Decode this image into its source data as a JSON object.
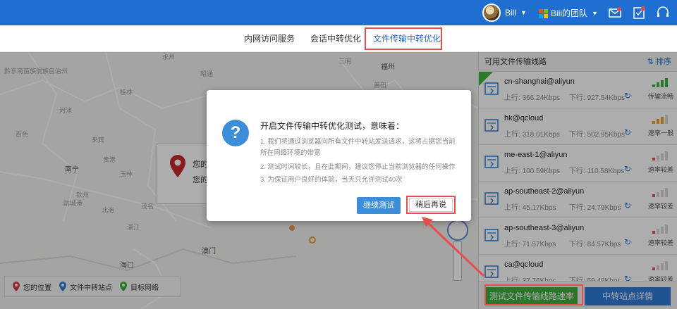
{
  "header": {
    "user_name": "Bill",
    "team_name": "Bill的团队",
    "icons": [
      "envelope-icon",
      "clipboard-check-icon",
      "headset-icon"
    ]
  },
  "tabs": [
    {
      "label": "内网访问服务",
      "active": false
    },
    {
      "label": "会话中转优化",
      "active": false
    },
    {
      "label": "文件传输中转优化",
      "active": true
    }
  ],
  "map": {
    "labels_big": [
      "南宁",
      "海口",
      "澳门",
      "福州"
    ],
    "labels": [
      "永州",
      "百色",
      "南宁",
      "钦州",
      "防城港",
      "北海",
      "玉林",
      "贵港",
      "来宾",
      "河池",
      "桂林",
      "茂名",
      "阳江",
      "湛江",
      "三明",
      "莆田",
      "黔东南苗族侗族自治州",
      "黔西南布依族苗族自治州",
      "昭通"
    ],
    "popup_text": [
      "您的",
      "您的"
    ],
    "legend": [
      {
        "label": "您的位置",
        "color": "#d9363e"
      },
      {
        "label": "文件中转站点",
        "color": "#2e7bd8"
      },
      {
        "label": "目标网络",
        "color": "#3fae3f"
      }
    ]
  },
  "panel": {
    "title": "可用文件传输线路",
    "sort_label": "排序",
    "up_label": "上行",
    "down_label": "下行",
    "routes": [
      {
        "name": "cn-shanghai@aliyun",
        "up": "366.24Kbps",
        "down": "927.54Kbps",
        "status": "传输流畅",
        "bars": 4,
        "color": "#3fae3f",
        "new": true
      },
      {
        "name": "hk@qcloud",
        "up": "318.01Kbps",
        "down": "502.95Kbps",
        "status": "速率一般",
        "bars": 3,
        "color": "#f0a020",
        "new": false
      },
      {
        "name": "me-east-1@aliyun",
        "up": "100.59Kbps",
        "down": "110.58Kbps",
        "status": "速率较差",
        "bars": 1,
        "color": "#e84c4c",
        "new": false
      },
      {
        "name": "ap-southeast-2@aliyun",
        "up": "45.17Kbps",
        "down": "24.79Kbps",
        "status": "速率较差",
        "bars": 1,
        "color": "#e84c4c",
        "new": false
      },
      {
        "name": "ap-southeast-3@aliyun",
        "up": "71.57Kbps",
        "down": "84.57Kbps",
        "status": "速率较差",
        "bars": 1,
        "color": "#e84c4c",
        "new": false
      },
      {
        "name": "ca@qcloud",
        "up": "37.76Kbps",
        "down": "59.49Kbps",
        "status": "速率较差",
        "bars": 1,
        "color": "#e84c4c",
        "new": false
      }
    ],
    "btn_test": "测试文件传输线路速率",
    "btn_detail": "中转站点详情"
  },
  "modal": {
    "title": "开启文件传输中转优化测试，意味着：",
    "lines": [
      "1. 我们将通过浏览器向所有文件中转站发送请求，这将占据您当前所在网络环境的带宽",
      "2. 测试时间较长，且在此期间，建议您停止当前浏览器的任何操作",
      "3. 为保证用户良好的体验，当天只允许测试40次"
    ],
    "btn_continue": "继续测试",
    "btn_later": "稍后再说"
  }
}
